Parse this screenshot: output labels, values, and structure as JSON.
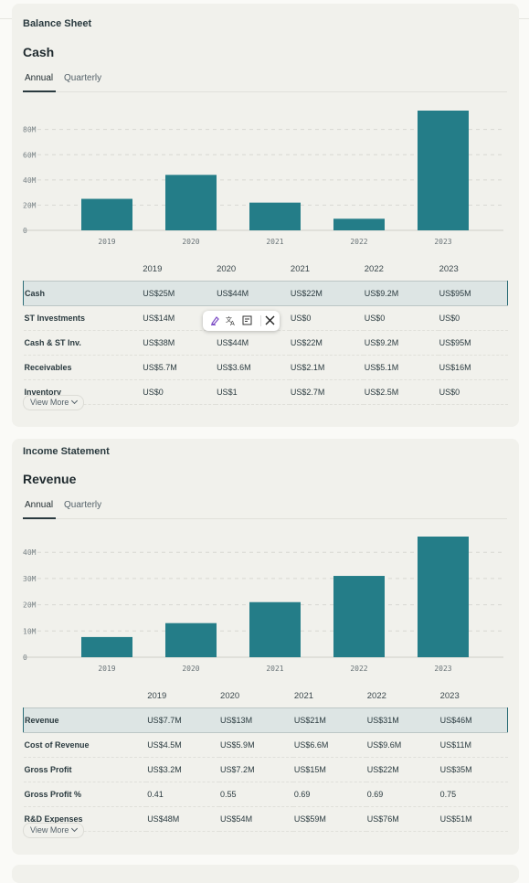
{
  "balance_sheet": {
    "section_title": "Balance Sheet",
    "metric_title": "Cash",
    "tabs": [
      "Annual",
      "Quarterly"
    ],
    "active_tab": "Annual",
    "chart_data": {
      "type": "bar",
      "categories": [
        "2019",
        "2020",
        "2021",
        "2022",
        "2023"
      ],
      "values": [
        25,
        44,
        22,
        9.2,
        95
      ],
      "ylim": [
        0,
        95
      ],
      "y_ticks": [
        0,
        20,
        40,
        60,
        80
      ],
      "y_tick_labels": [
        "0",
        "20M",
        "40M",
        "60M",
        "80M"
      ],
      "bar_color": "#247d88",
      "grid": true
    },
    "table": {
      "headers": [
        "",
        "2019",
        "2020",
        "2021",
        "2022",
        "2023"
      ],
      "rows": [
        [
          "Cash",
          "US$25M",
          "US$44M",
          "US$22M",
          "US$9.2M",
          "US$95M"
        ],
        [
          "ST Investments",
          "US$14M",
          "",
          "US$0",
          "US$0",
          "US$0"
        ],
        [
          "Cash & ST Inv.",
          "US$38M",
          "US$44M",
          "US$22M",
          "US$9.2M",
          "US$95M"
        ],
        [
          "Receivables",
          "US$5.7M",
          "US$3.6M",
          "US$2.1M",
          "US$5.1M",
          "US$16M"
        ],
        [
          "Inventory",
          "US$0",
          "US$1",
          "US$2.7M",
          "US$2.5M",
          "US$0"
        ]
      ]
    },
    "view_more": "View More"
  },
  "income_statement": {
    "section_title": "Income Statement",
    "metric_title": "Revenue",
    "tabs": [
      "Annual",
      "Quarterly"
    ],
    "active_tab": "Annual",
    "chart_data": {
      "type": "bar",
      "categories": [
        "2019",
        "2020",
        "2021",
        "2022",
        "2023"
      ],
      "values": [
        7.7,
        13,
        21,
        31,
        46
      ],
      "ylim": [
        0,
        46
      ],
      "y_ticks": [
        0,
        10,
        20,
        30,
        40
      ],
      "y_tick_labels": [
        "0",
        "10M",
        "20M",
        "30M",
        "40M"
      ],
      "bar_color": "#247d88",
      "grid": true
    },
    "table": {
      "headers": [
        "",
        "2019",
        "2020",
        "2021",
        "2022",
        "2023"
      ],
      "rows": [
        [
          "Revenue",
          "US$7.7M",
          "US$13M",
          "US$21M",
          "US$31M",
          "US$46M"
        ],
        [
          "Cost of Revenue",
          "US$4.5M",
          "US$5.9M",
          "US$6.6M",
          "US$9.6M",
          "US$11M"
        ],
        [
          "Gross Profit",
          "US$3.2M",
          "US$7.2M",
          "US$15M",
          "US$22M",
          "US$35M"
        ],
        [
          "Gross Profit %",
          "0.41",
          "0.55",
          "0.69",
          "0.69",
          "0.75"
        ],
        [
          "R&D Expenses",
          "US$48M",
          "US$54M",
          "US$59M",
          "US$76M",
          "US$51M"
        ]
      ]
    },
    "view_more": "View More"
  },
  "popup": {
    "icons": [
      "highlight-icon",
      "translate-icon",
      "note-icon",
      "share-x-icon"
    ]
  }
}
